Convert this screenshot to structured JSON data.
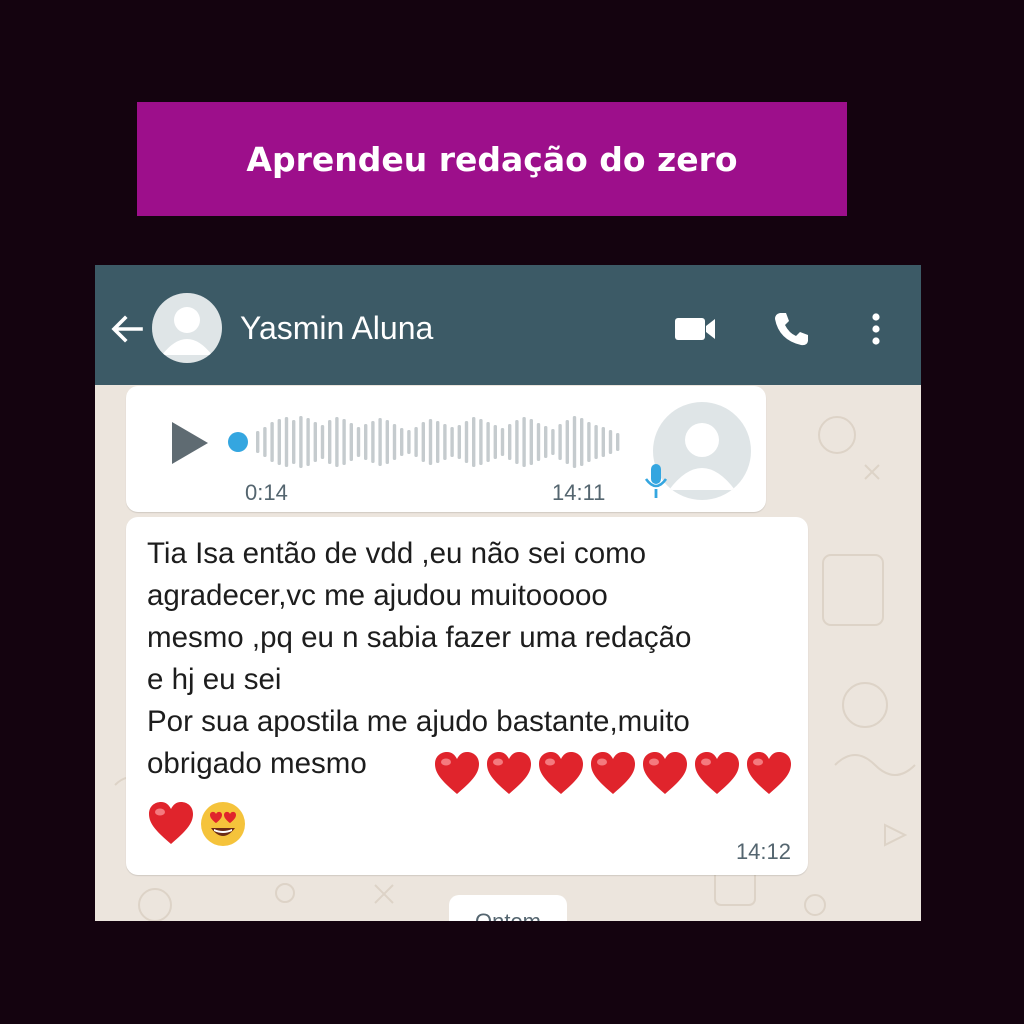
{
  "banner": {
    "title": "Aprendeu redação do zero"
  },
  "chat": {
    "contact_name": "Yasmin Aluna",
    "icons": {
      "back": "back-arrow-icon",
      "avatar": "default-avatar-icon",
      "video": "video-call-icon",
      "call": "phone-call-icon",
      "more": "more-vertical-icon"
    },
    "voice_message": {
      "duration": "0:14",
      "time": "14:11",
      "played": false
    },
    "text_message": {
      "text": "Tia Isa então de vdd ,eu não sei como\nagradecer,vc me ajudou muitooooo\nmesmo ,pq eu n sabia fazer uma redação\ne hj eu sei\nPor sua apostila me ajudo bastante,muito\nobrigado mesmo",
      "emoji": "❤️❤️❤️❤️❤️❤️❤️❤️😍",
      "time": "14:12"
    },
    "date_separator": "Ontem"
  },
  "colors": {
    "page_background": "#14030f",
    "banner": "#9d0f8b",
    "header": "#3c5a66",
    "chat_background": "#ece5dd",
    "bubble": "#ffffff",
    "voice_dot": "#34a6e0",
    "heart": "#e0242c"
  }
}
